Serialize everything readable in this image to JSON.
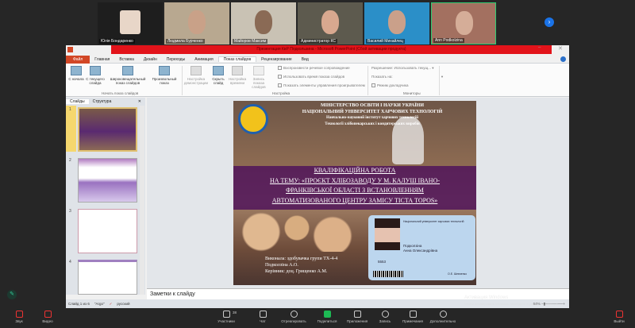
{
  "participants": [
    {
      "name": "Юлія Бондаренко",
      "muted": true
    },
    {
      "name": "Людмила Бурченко",
      "muted": false
    },
    {
      "name": "Майоров Максим",
      "muted": true
    },
    {
      "name": "Администратор КС",
      "muted": true
    },
    {
      "name": "Василий Михайлец",
      "muted": true
    },
    {
      "name": "Ann Podkolzina",
      "muted": false
    }
  ],
  "ppt": {
    "title": "Презентация КвР Подкользина - Microsoft PowerPoint (Сбой активации продукта)",
    "tabs": [
      "Файл",
      "Главная",
      "Вставка",
      "Дизайн",
      "Переходы",
      "Анимация",
      "Показ слайдов",
      "Рецензирование",
      "Вид"
    ],
    "active_tab": "Показ слайдов",
    "ribbon": {
      "from_start": "С начала",
      "from_current": "С текущего слайда",
      "broadcast": "Широковещательный показ слайдов",
      "custom": "Произвольный показ",
      "group_start": "Начать показ слайдов",
      "setup": "Настройка демонстрации",
      "hide": "Скрыть слайд",
      "timings": "Настройка времени",
      "record": "Запись показа слайдов",
      "check1": "Воспроизвести речевое сопровождение",
      "check2": "Использовать время показа слайдов",
      "check3": "Показать элементы управления проигрывателем",
      "group_setup": "Настройка",
      "resolution_label": "Разрешение:",
      "resolution_value": "Использовать текущ...",
      "show_on_label": "Показать на:",
      "presenter": "Режим докладчика",
      "group_monitors": "Мониторы"
    },
    "pane_tabs": [
      "Слайды",
      "Структура"
    ],
    "slide_numbers": [
      "1",
      "2",
      "3",
      "4"
    ],
    "slide": {
      "header": [
        "МІНІСТЕРСТВО ОСВІТИ І НАУКИ УКРАЇНИ",
        "НАЦІОНАЛЬНИЙ УНІВЕРСИТЕТ ХАРЧОВИХ ТЕХНОЛОГІЙ",
        "Навчально-науковий інститут харчових технологій",
        "Технології хлібопекарських і кондитерських виробів"
      ],
      "title": [
        "КВАЛІФІКАЦІЙНА РОБОТА",
        "НА ТЕМУ: «ПРОЄКТ ХЛІБОЗАВОДУ У М. КАЛУШ ІВАНО-",
        "ФРАНКІВСЬКОЇ ОБЛАСТІ З ВСТАНОВЛЕННЯМ",
        "АВТОМАТИЗОВАНОГО ЦЕНТРУ ЗАМІСУ ТІСТА TOPOS»"
      ],
      "authors": [
        "Виконала: здобувачка групи ТХ-4-4",
        "Подколзіна А.О.",
        "Керівник: доц. Грищенко А.М."
      ],
      "card": {
        "university": "Національний університет харчових технологій",
        "surname": "Подколзіна",
        "name": "Анна Олександрівна",
        "number": "5553",
        "signature": "О.Е. Шевченко"
      }
    },
    "notes_placeholder": "Заметки к слайду",
    "status": {
      "slide": "Слайд 1 из 6",
      "theme": "\"Argo\"",
      "language": "русский",
      "zoom": "64%"
    },
    "activation": "Активация Windows",
    "activation_sub": "Чтобы активировать Windows, перейдите в раздел \"Параметры\"."
  },
  "toolbar": {
    "audio": "Звук",
    "video": "Видео",
    "participants": "Участники",
    "participants_count": "38",
    "chat": "Чат",
    "react": "Отреагировать",
    "share": "Поделиться",
    "apps": "Приложения",
    "record": "Запись",
    "notes": "Примечания",
    "more": "Дополнительно",
    "leave": "Выйти"
  }
}
